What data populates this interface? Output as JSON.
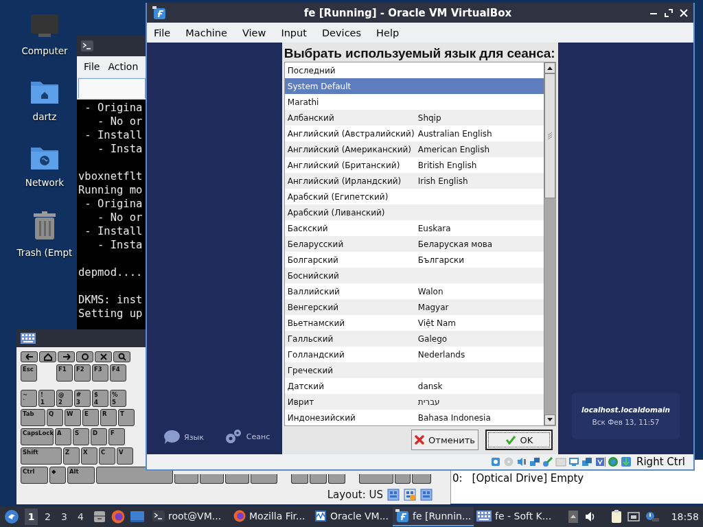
{
  "desktop_icons": [
    {
      "label": "Computer",
      "kind": "computer"
    },
    {
      "label": "dartz",
      "kind": "home"
    },
    {
      "label": "Network",
      "kind": "network"
    },
    {
      "label": "Trash (Empt",
      "kind": "trash"
    }
  ],
  "terminal": {
    "menu": [
      "File",
      "Action"
    ],
    "blocks": [
      [
        " - Origina",
        "   - No or",
        " - Install",
        "   - Insta"
      ],
      [
        "vboxnetflt",
        "Running mo",
        " - Origina",
        "   - No or",
        " - Install",
        "   - Insta"
      ],
      [
        "depmod...."
      ],
      [
        "DKMS: inst",
        "Setting up"
      ]
    ]
  },
  "keyboard": {
    "rows": [
      {
        "keys": [
          {
            "kind": "back"
          },
          {
            "kind": "home"
          },
          {
            "kind": "forward"
          },
          {
            "kind": "refresh"
          },
          {
            "kind": "close"
          },
          {
            "kind": "search"
          }
        ]
      },
      {
        "keys": [
          {
            "kind": "normal",
            "label": "Esc"
          },
          {
            "kind": "normal",
            "label": "F1"
          },
          {
            "kind": "normal",
            "label": "F2"
          },
          {
            "kind": "normal",
            "label": "F3"
          },
          {
            "kind": "normal",
            "label": "F4"
          }
        ]
      },
      {
        "keys": [
          {
            "kind": "normal",
            "label": "~",
            "sub": "`"
          },
          {
            "kind": "normal",
            "label": "!",
            "sub": "1"
          },
          {
            "kind": "normal",
            "label": "@",
            "sub": "2"
          },
          {
            "kind": "normal",
            "label": "#",
            "sub": "3"
          },
          {
            "kind": "normal",
            "label": "$",
            "sub": "4"
          },
          {
            "kind": "normal",
            "label": "%",
            "sub": "5"
          }
        ]
      },
      {
        "keys": [
          {
            "kind": "tab",
            "label": "Tab"
          },
          {
            "kind": "normal",
            "label": "Q"
          },
          {
            "kind": "normal",
            "label": "W"
          },
          {
            "kind": "normal",
            "label": "E"
          },
          {
            "kind": "normal",
            "label": "R"
          },
          {
            "kind": "normal",
            "label": "T"
          }
        ]
      },
      {
        "keys": [
          {
            "kind": "caps",
            "label": "CapsLock"
          },
          {
            "kind": "normal",
            "label": "A"
          },
          {
            "kind": "normal",
            "label": "S"
          },
          {
            "kind": "normal",
            "label": "D"
          },
          {
            "kind": "normal",
            "label": "F"
          }
        ]
      },
      {
        "keys": [
          {
            "kind": "shift",
            "label": "Shift"
          },
          {
            "kind": "normal",
            "label": "Z"
          },
          {
            "kind": "normal",
            "label": "X"
          },
          {
            "kind": "normal",
            "label": "C"
          },
          {
            "kind": "normal",
            "label": "V"
          }
        ]
      },
      {
        "keys": [
          {
            "kind": "ctrl",
            "label": "Ctrl"
          },
          {
            "kind": "normal",
            "label": "◆"
          },
          {
            "kind": "ctrl",
            "label": "Alt"
          },
          {
            "kind": "space"
          }
        ]
      }
    ],
    "layout": "Layout: US"
  },
  "vm_window": {
    "title": "fe [Running] - Oracle VM VirtualBox",
    "menu": [
      "File",
      "Machine",
      "View",
      "Input",
      "Devices",
      "Help"
    ],
    "side_items": [
      {
        "label": "Язык",
        "kind": "language"
      },
      {
        "label": "Сеанс",
        "kind": "session"
      }
    ],
    "dialog": {
      "heading": "Выбрать используемый язык для сеанса:",
      "languages": [
        {
          "name": "Последний",
          "selected": false
        },
        {
          "name": "System Default",
          "selected": true
        },
        {
          "name": "Marathi",
          "selected": false
        },
        {
          "name": "Албанский",
          "native": "Shqip",
          "selected": false
        },
        {
          "name": "Английский (Австралийский)",
          "native": "Australian English",
          "selected": false
        },
        {
          "name": "Английский (Американский)",
          "native": "American English",
          "selected": false
        },
        {
          "name": "Английский (Британский)",
          "native": "British English",
          "selected": false
        },
        {
          "name": "Английский (Ирландский)",
          "native": "Irish English",
          "selected": false
        },
        {
          "name": "Арабский (Египетский)",
          "selected": false
        },
        {
          "name": "Арабский (Ливанский)",
          "selected": false
        },
        {
          "name": "Баскский",
          "native": "Euskara",
          "selected": false
        },
        {
          "name": "Беларусский",
          "native": "Беларуская мова",
          "selected": false
        },
        {
          "name": "Болгарский",
          "native": "Български",
          "selected": false
        },
        {
          "name": "Боснийский",
          "selected": false
        },
        {
          "name": "Валлийский",
          "native": "Walon",
          "selected": false
        },
        {
          "name": "Венгерский",
          "native": "Magyar",
          "selected": false
        },
        {
          "name": "Вьетнамский",
          "native": "Việt Nam",
          "selected": false
        },
        {
          "name": "Галльский",
          "native": "Galego",
          "selected": false
        },
        {
          "name": "Голландский",
          "native": "Nederlands",
          "selected": false
        },
        {
          "name": "Греческий",
          "selected": false
        },
        {
          "name": "Датский",
          "native": "dansk",
          "selected": false
        },
        {
          "name": "Иврит",
          "native": "עברית",
          "selected": false
        },
        {
          "name": "Индонезийский",
          "native": "Bahasa Indonesia",
          "selected": false
        }
      ],
      "cancel": "Отменить",
      "ok": "OK"
    },
    "host_card": {
      "hostname": "localhost.localdomain",
      "datetime": "Вск Фев 13, 11:57"
    },
    "host_key": "Right Ctrl"
  },
  "manager_window": {
    "slot": "0:",
    "device": "[Optical Drive] Empty"
  },
  "taskbar": {
    "workspaces": [
      {
        "label": "1",
        "selected": true
      },
      {
        "label": "2",
        "selected": false
      },
      {
        "label": "3",
        "selected": false
      },
      {
        "label": "4",
        "selected": false
      }
    ],
    "tasks": [
      {
        "label": "root@VM...",
        "kind": "terminal",
        "selected": false
      },
      {
        "label": "Mozilla Fir...",
        "kind": "browser",
        "selected": false
      },
      {
        "label": "Oracle VM...",
        "kind": "monitor",
        "selected": false
      },
      {
        "label": "fe [Runnin...",
        "kind": "vm",
        "selected": true
      },
      {
        "label": "fe - Soft K...",
        "kind": "keyboard",
        "selected": false
      }
    ],
    "clock": "18:58"
  }
}
